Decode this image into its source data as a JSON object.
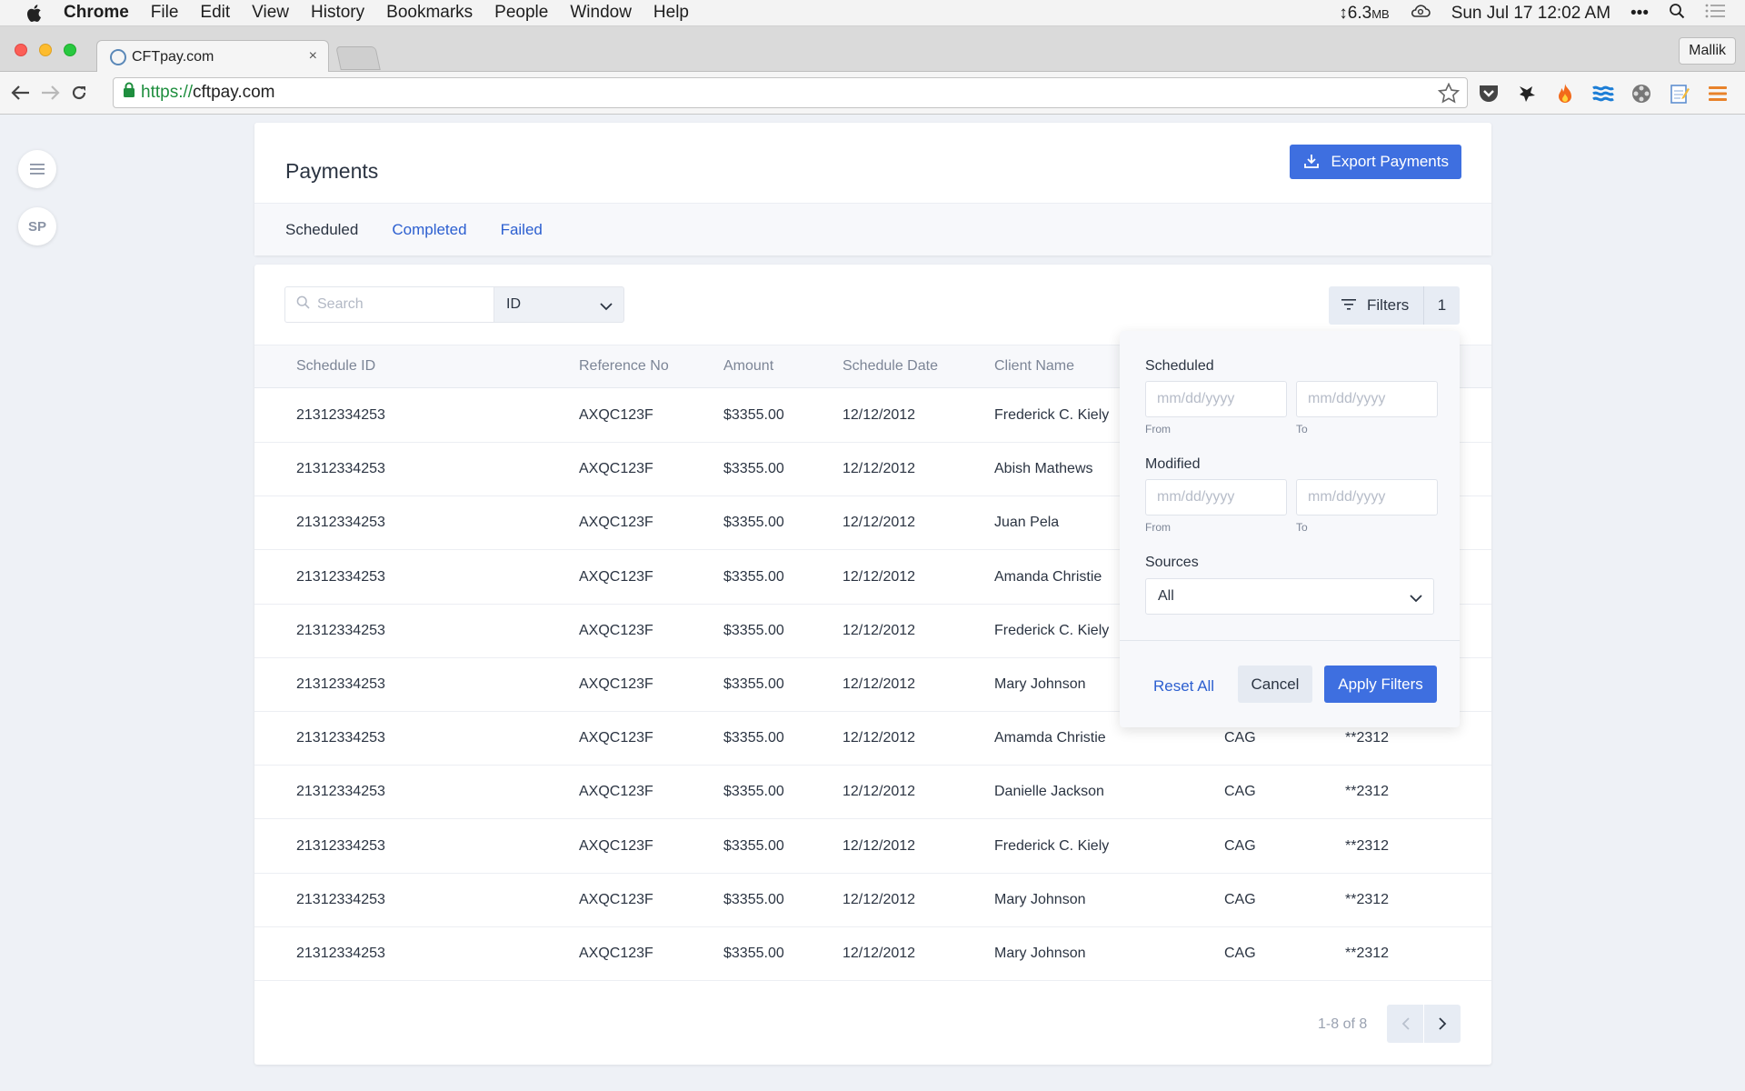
{
  "os_menu": {
    "app": "Chrome",
    "items": [
      "File",
      "Edit",
      "View",
      "History",
      "Bookmarks",
      "People",
      "Window",
      "Help"
    ],
    "memory": "↕6.3",
    "memory_unit": "MB",
    "datetime": "Sun Jul 17  12:02 AM",
    "dots": "•••"
  },
  "browser": {
    "tab_title": "CFTpay.com",
    "tab_close": "×",
    "profile": "Mallik",
    "url_scheme": "https://",
    "url_host": "cftpay.com"
  },
  "rail": {
    "avatar": "SP"
  },
  "page": {
    "title": "Payments",
    "export_label": "Export Payments",
    "tabs": [
      {
        "label": "Scheduled",
        "active": true
      },
      {
        "label": "Completed",
        "active": false
      },
      {
        "label": "Failed",
        "active": false
      }
    ]
  },
  "toolbar": {
    "search_placeholder": "Search",
    "search_by": "ID",
    "filters_label": "Filters",
    "filters_count": "1"
  },
  "table": {
    "columns": [
      "Schedule ID",
      "Reference No",
      "Amount",
      "Schedule Date",
      "Client Name"
    ],
    "rows": [
      [
        "21312334253",
        "AXQC123F",
        "$3355.00",
        "12/12/2012",
        "Frederick C. Kiely",
        "",
        ""
      ],
      [
        "21312334253",
        "AXQC123F",
        "$3355.00",
        "12/12/2012",
        "Abish Mathews",
        "",
        ""
      ],
      [
        "21312334253",
        "AXQC123F",
        "$3355.00",
        "12/12/2012",
        "Juan Pela",
        "",
        ""
      ],
      [
        "21312334253",
        "AXQC123F",
        "$3355.00",
        "12/12/2012",
        "Amanda Christie",
        "",
        ""
      ],
      [
        "21312334253",
        "AXQC123F",
        "$3355.00",
        "12/12/2012",
        "Frederick C. Kiely",
        "",
        ""
      ],
      [
        "21312334253",
        "AXQC123F",
        "$3355.00",
        "12/12/2012",
        "Mary Johnson",
        "",
        ""
      ],
      [
        "21312334253",
        "AXQC123F",
        "$3355.00",
        "12/12/2012",
        "Amamda Christie",
        "CAG",
        "**2312"
      ],
      [
        "21312334253",
        "AXQC123F",
        "$3355.00",
        "12/12/2012",
        "Danielle Jackson",
        "CAG",
        "**2312"
      ],
      [
        "21312334253",
        "AXQC123F",
        "$3355.00",
        "12/12/2012",
        "Frederick C. Kiely",
        "CAG",
        "**2312"
      ],
      [
        "21312334253",
        "AXQC123F",
        "$3355.00",
        "12/12/2012",
        "Mary Johnson",
        "CAG",
        "**2312"
      ],
      [
        "21312334253",
        "AXQC123F",
        "$3355.00",
        "12/12/2012",
        "Mary Johnson",
        "CAG",
        "**2312"
      ]
    ]
  },
  "pagination": {
    "text": "1-8 of 8"
  },
  "filter_panel": {
    "scheduled_label": "Scheduled",
    "modified_label": "Modified",
    "sources_label": "Sources",
    "date_placeholder": "mm/dd/yyyy",
    "from_label": "From",
    "to_label": "To",
    "sources_value": "All",
    "reset_label": "Reset All",
    "cancel_label": "Cancel",
    "apply_label": "Apply Filters"
  },
  "colors": {
    "accent": "#3e6fe0",
    "link": "#2c5fd0",
    "page_bg": "#eef1f6"
  }
}
